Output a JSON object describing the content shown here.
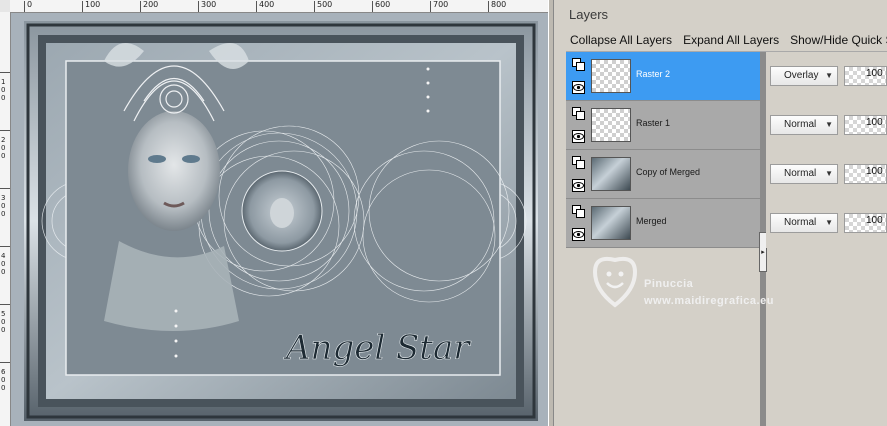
{
  "ruler": {
    "top_labels": [
      "0",
      "100",
      "200",
      "300",
      "400",
      "500",
      "600",
      "700",
      "800"
    ],
    "left_digits": [
      "1",
      "0",
      "0",
      "2",
      "0",
      "0",
      "3",
      "0",
      "0",
      "4",
      "0",
      "0",
      "5",
      "0",
      "0",
      "6",
      "0",
      "0"
    ]
  },
  "canvas": {
    "signature": "Angel Star"
  },
  "layers_panel": {
    "title": "Layers",
    "toolbar": {
      "collapse": "Collapse All Layers",
      "expand": "Expand All Layers",
      "quick_search": "Show/Hide Quick Sear"
    },
    "layers": [
      {
        "name": "Raster 2",
        "blend": "Overlay",
        "opacity": "100",
        "selected": true,
        "thumb": "transparent"
      },
      {
        "name": "Raster 1",
        "blend": "Normal",
        "opacity": "100",
        "selected": false,
        "thumb": "transparent"
      },
      {
        "name": "Copy of Merged",
        "blend": "Normal",
        "opacity": "100",
        "selected": false,
        "thumb": "image"
      },
      {
        "name": "Merged",
        "blend": "Normal",
        "opacity": "100",
        "selected": false,
        "thumb": "image"
      }
    ]
  },
  "watermark": {
    "line1": "Pinuccia",
    "line2": "www.maidiregrafica.eu"
  },
  "colors": {
    "selected_row": "#3d9bf2",
    "panel_bg": "#d4d0c8",
    "layers_bg": "#a9a9a9"
  }
}
